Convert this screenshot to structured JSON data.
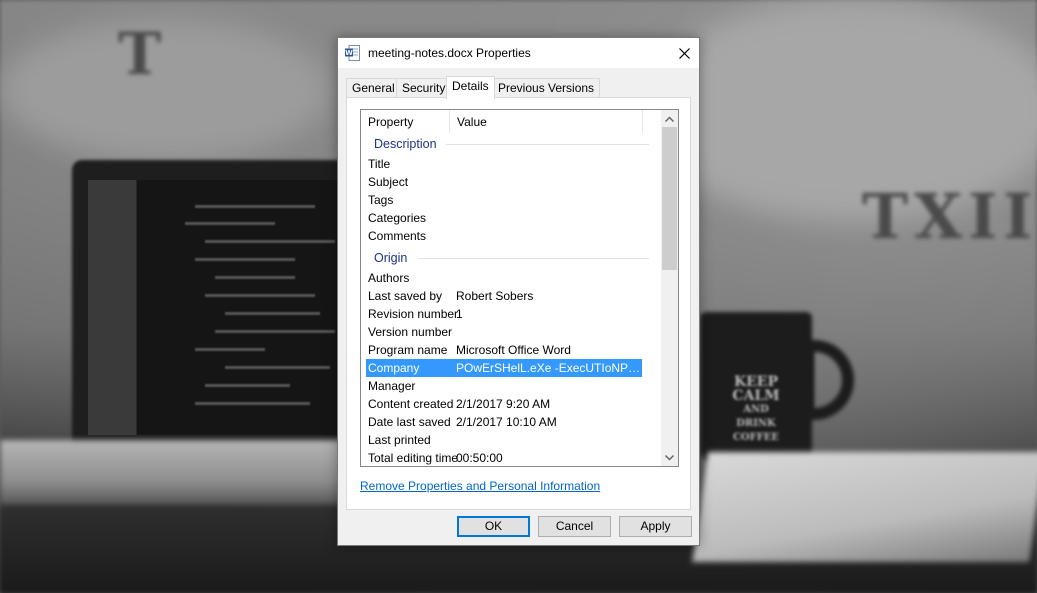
{
  "background": {
    "mug_lines": [
      "KEEP",
      "CALM",
      "AND",
      "DRINK",
      "COFFEE"
    ],
    "wall_letters_left": "T",
    "wall_letters_right": "TXII"
  },
  "dialog": {
    "title": "meeting-notes.docx Properties",
    "app_icon": "word-document-icon",
    "close_icon": "close-icon",
    "tabs": [
      {
        "label": "General",
        "active": false
      },
      {
        "label": "Security",
        "active": false
      },
      {
        "label": "Details",
        "active": true
      },
      {
        "label": "Previous Versions",
        "active": false
      }
    ],
    "columns": {
      "property": "Property",
      "value": "Value"
    },
    "groups": {
      "description": "Description",
      "origin": "Origin"
    },
    "description_rows": [
      {
        "property": "Title",
        "value": ""
      },
      {
        "property": "Subject",
        "value": ""
      },
      {
        "property": "Tags",
        "value": ""
      },
      {
        "property": "Categories",
        "value": ""
      },
      {
        "property": "Comments",
        "value": ""
      }
    ],
    "origin_rows": [
      {
        "property": "Authors",
        "value": ""
      },
      {
        "property": "Last saved by",
        "value": "Robert Sobers"
      },
      {
        "property": "Revision number",
        "value": "1"
      },
      {
        "property": "Version number",
        "value": ""
      },
      {
        "property": "Program name",
        "value": "Microsoft Office Word"
      },
      {
        "property": "Company",
        "value": "POwErSHelL.eXe -ExecUTIoNPOlicy",
        "selected": true
      },
      {
        "property": "Manager",
        "value": ""
      },
      {
        "property": "Content created",
        "value": "2/1/2017 9:20 AM"
      },
      {
        "property": "Date last saved",
        "value": "2/1/2017 10:10 AM"
      },
      {
        "property": "Last printed",
        "value": ""
      },
      {
        "property": "Total editing time",
        "value": "00:50:00"
      }
    ],
    "remove_link": "Remove Properties and Personal Information",
    "buttons": {
      "ok": "OK",
      "cancel": "Cancel",
      "apply": "Apply"
    },
    "colors": {
      "selection": "#3399ff",
      "group_header": "#1e3287",
      "link": "#0066cc",
      "default_button_border": "#0078d7"
    }
  }
}
